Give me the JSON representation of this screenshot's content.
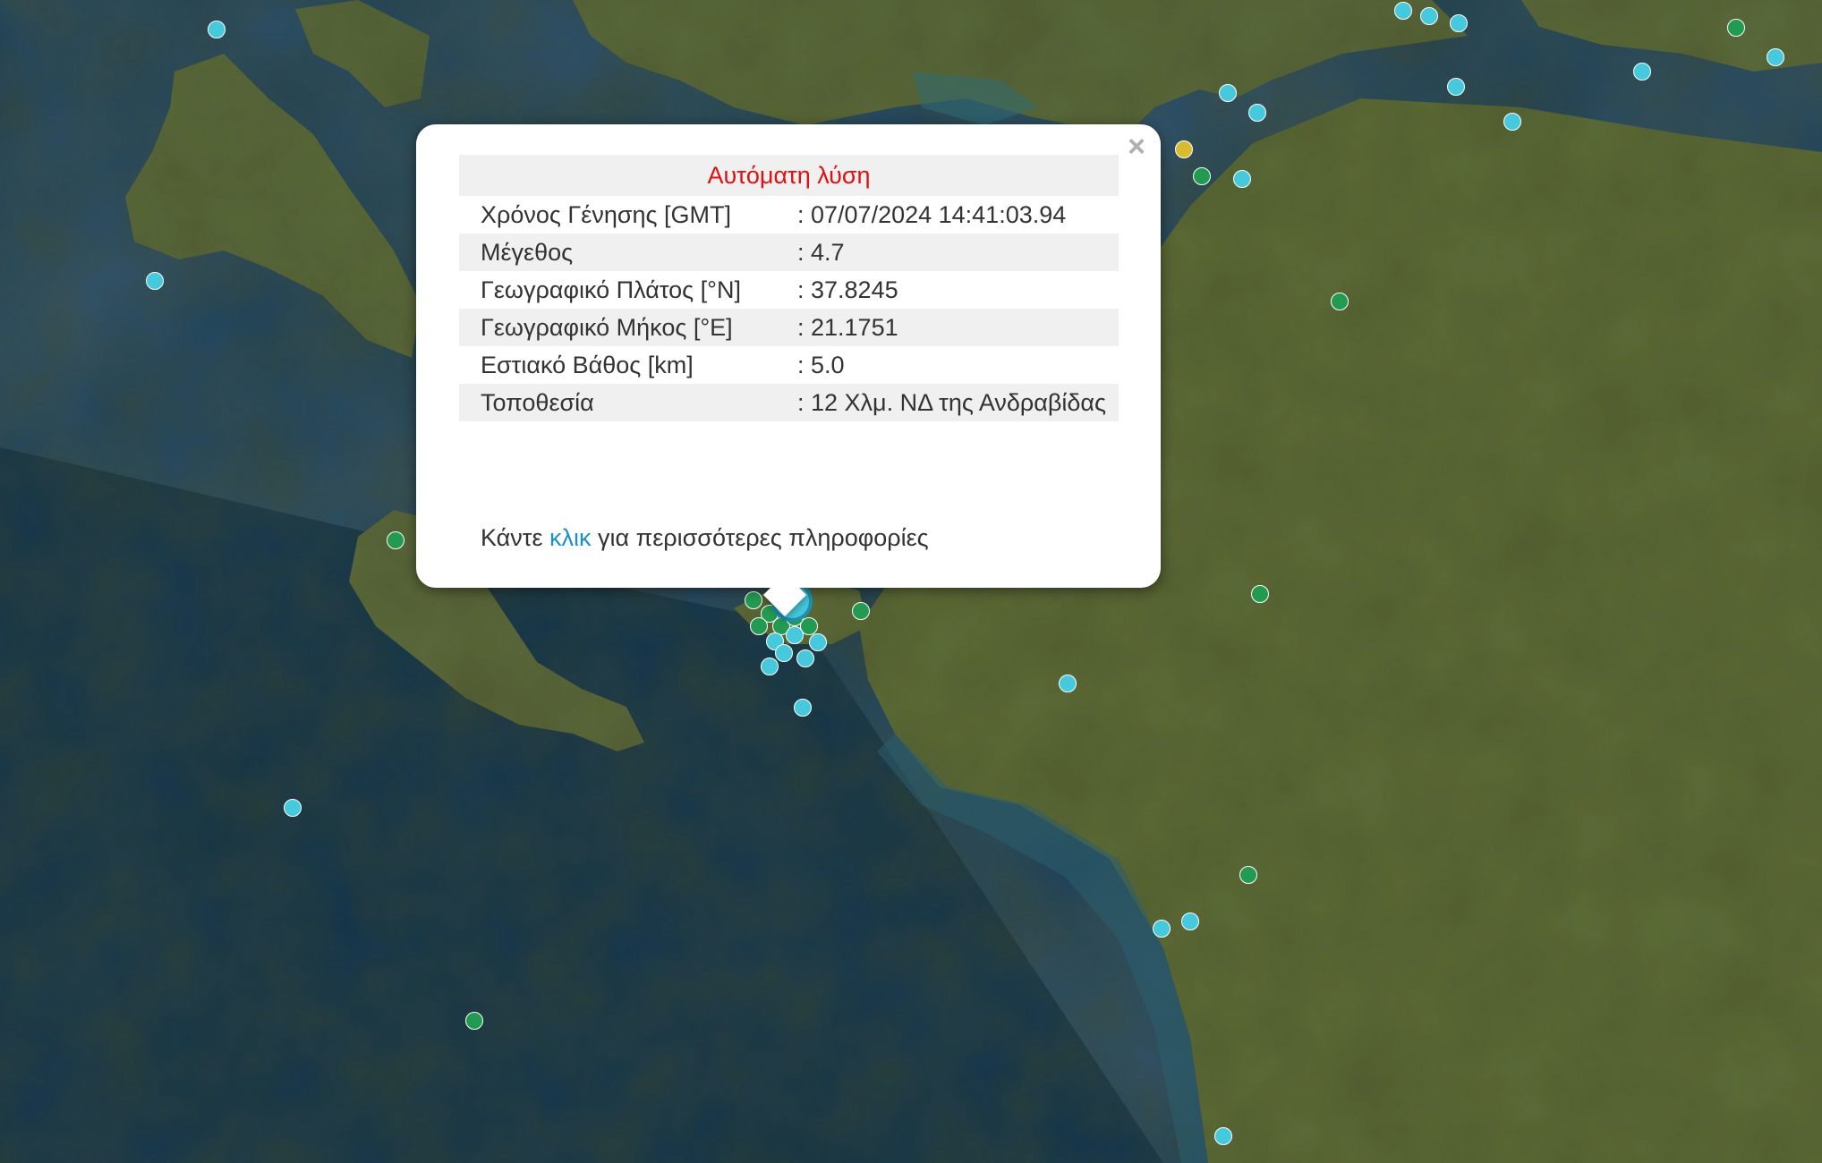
{
  "popup": {
    "header": "Αυτόματη λύση",
    "rows": [
      {
        "label": "Χρόνος Γένησης [GMT]",
        "value": ": 07/07/2024 14:41:03.94"
      },
      {
        "label": "Μέγεθος",
        "value": ": 4.7"
      },
      {
        "label": "Γεωγραφικό Πλάτος [°N]",
        "value": ": 37.8245"
      },
      {
        "label": "Γεωγραφικό Μήκος [°E]",
        "value": ": 21.1751"
      },
      {
        "label": "Εστιακό Βάθος [km]",
        "value": ": 5.0"
      },
      {
        "label": "Τοποθεσία",
        "value": ": 12 Χλμ. ΝΔ της Ανδραβίδας"
      }
    ],
    "footer_before": "Κάντε ",
    "footer_link": "κλικ",
    "footer_after": " για περισσότερες πληροφορίες",
    "close_symbol": "×"
  },
  "colors": {
    "sea": "#12324a",
    "land": "#586a35",
    "marker_recent": "#46c9dd",
    "marker_older": "#239a51",
    "marker_other": "#d8bb31",
    "popup_header_text": "#e01010",
    "link": "#1a8fc9"
  }
}
